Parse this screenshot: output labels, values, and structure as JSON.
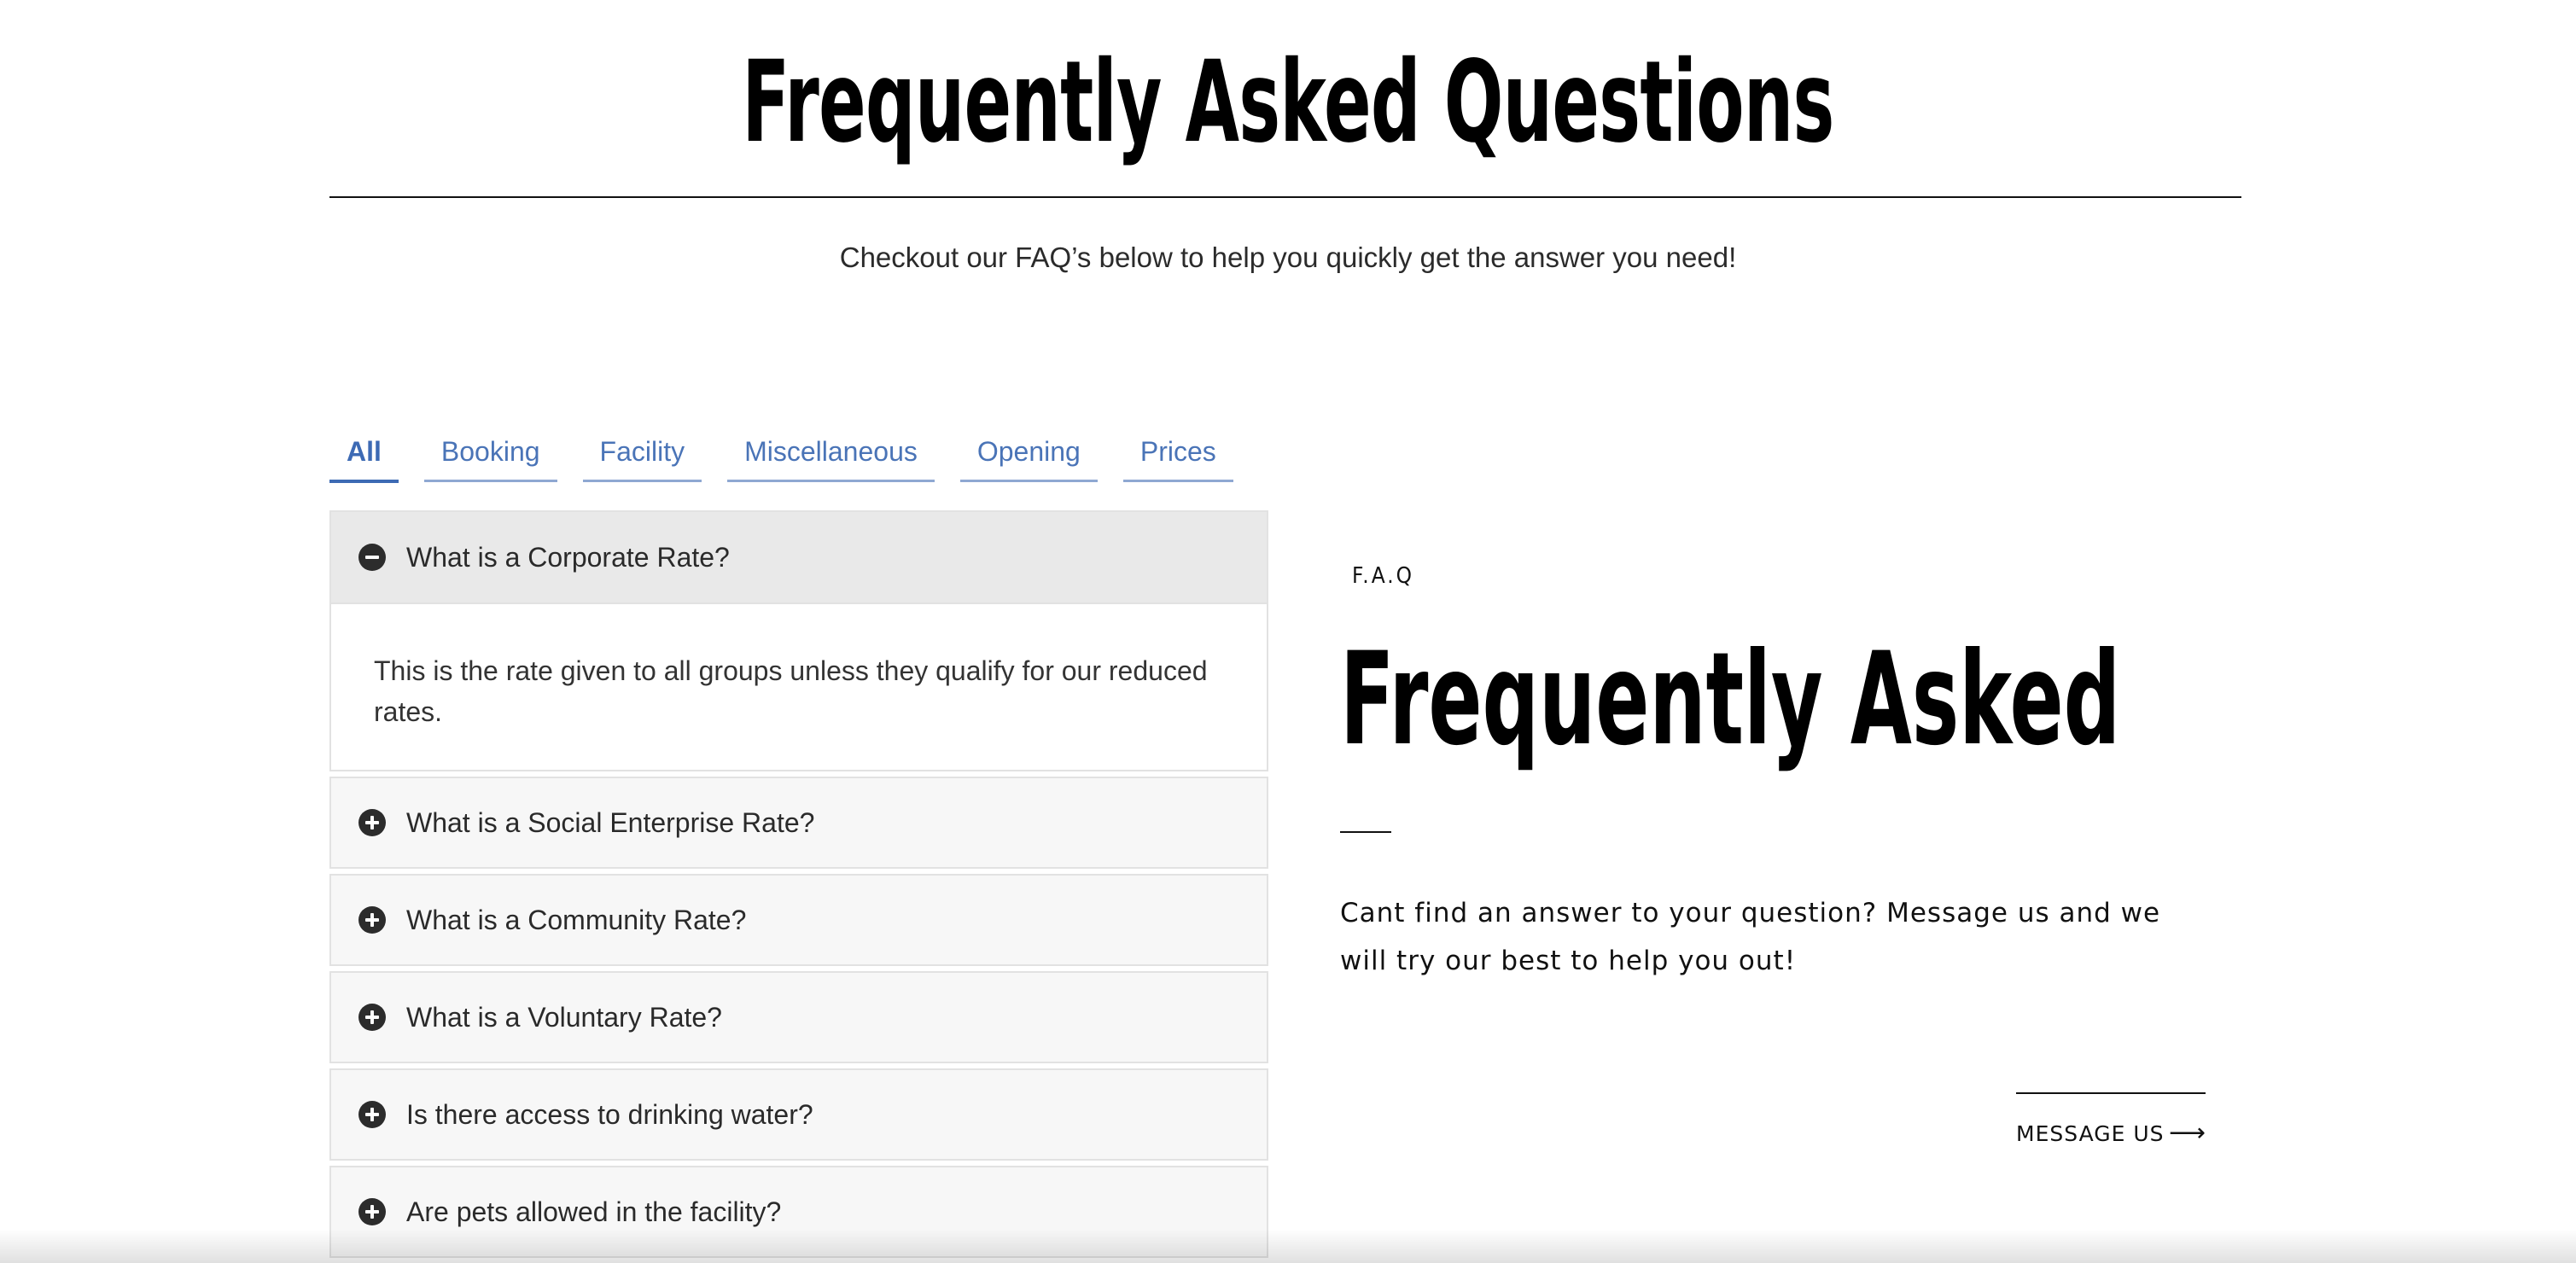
{
  "header": {
    "title": "Frequently Asked Questions",
    "subtitle": "Checkout our FAQ’s below to help you quickly get the answer you need!"
  },
  "tabs": [
    {
      "label": "All",
      "active": true
    },
    {
      "label": "Booking",
      "active": false
    },
    {
      "label": "Facility",
      "active": false
    },
    {
      "label": "Miscellaneous",
      "active": false
    },
    {
      "label": "Opening",
      "active": false
    },
    {
      "label": "Prices",
      "active": false
    }
  ],
  "faq": [
    {
      "question": "What is a Corporate Rate?",
      "answer": "This is the rate given to all groups unless they qualify for our reduced rates.",
      "expanded": true
    },
    {
      "question": "What is a Social Enterprise Rate?",
      "expanded": false
    },
    {
      "question": "What is a Community Rate?",
      "expanded": false
    },
    {
      "question": "What is a Voluntary Rate?",
      "expanded": false
    },
    {
      "question": "Is there access to drinking water?",
      "expanded": false
    },
    {
      "question": "Are pets allowed in the facility?",
      "expanded": false
    }
  ],
  "side": {
    "eyebrow": "F.A.Q",
    "heading": "Frequently Asked",
    "text": "Cant find an answer to your question? Message us and we will try our best to help you out!",
    "button_label": "MESSAGE US",
    "button_icon": "arrow-right-icon"
  },
  "colors": {
    "accent": "#3d6ab4",
    "tab_text": "#4a74b7",
    "faq_bg": "#f7f7f7",
    "faq_open_bg": "#e9e9e9"
  }
}
